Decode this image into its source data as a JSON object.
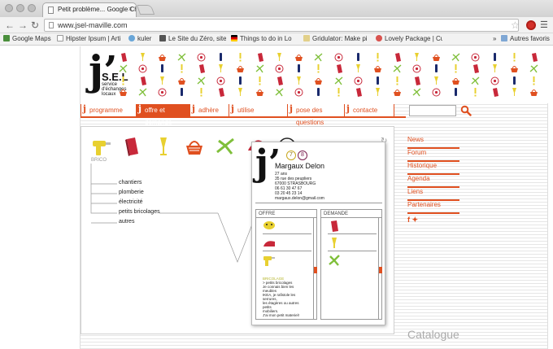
{
  "browser": {
    "tab_title": "Petit problème... Google Chr",
    "tab_close": "×",
    "url": "www.jsel-maville.com",
    "bookmarks": [
      "Google Maps",
      "Hipster Ipsum | Arti",
      "kuler",
      "Le Site du Zéro, site",
      "Things to do in Lo",
      "Gridulator: Make pi",
      "Lovely Package | Cu"
    ],
    "bookmarks_overflow": "»",
    "other_bookmarks": "Autres favoris"
  },
  "site": {
    "logo_letter": "j’",
    "logo_name": "S.E.L",
    "logo_tagline": "service d'échanges locaux",
    "nav": [
      {
        "label": "programme"
      },
      {
        "label": "offre et demande"
      },
      {
        "label": "adhère"
      },
      {
        "label": "utilise"
      },
      {
        "label": "pose des questions"
      },
      {
        "label": "contacte"
      }
    ],
    "nav_prefix": "j",
    "category_label": "BRICO",
    "sub_categories": [
      "chantiers",
      "plomberie",
      "électricité",
      "petits bricolages",
      "autres"
    ],
    "side_links": [
      "News",
      "Forum",
      "Historique",
      "Agenda",
      "Liens",
      "Partenaires"
    ],
    "social": "f ✦",
    "catalogue": "Catalogue",
    "refresh": "↻"
  },
  "card": {
    "logo_letter": "j’",
    "badge_offers": "7",
    "badge_demands": "8",
    "name": "Margaux Delon",
    "info": [
      "27 ans",
      "35 rue des peupliers",
      "67000 STRASBOURG",
      "06 61 30 47 67",
      "03 20 45 23 14",
      "margaux.delon@gmail.com"
    ],
    "offer_header": "OFFRE",
    "demand_header": "DEMANDE",
    "offer_tag": "BRICOLAGE",
    "offer_lines": [
      "> petits bricolages",
      "Je connais bien les meubles",
      "IKEA, je rafistole les serrures,",
      "les étagères ou autres petits",
      "mobiliers.",
      "J'ai mon petit materiel!"
    ]
  },
  "colors": {
    "accent": "#e05020",
    "red": "#c8283a",
    "yellow": "#e8d030",
    "navy": "#1a2a6c",
    "green": "#7fbf3a"
  }
}
